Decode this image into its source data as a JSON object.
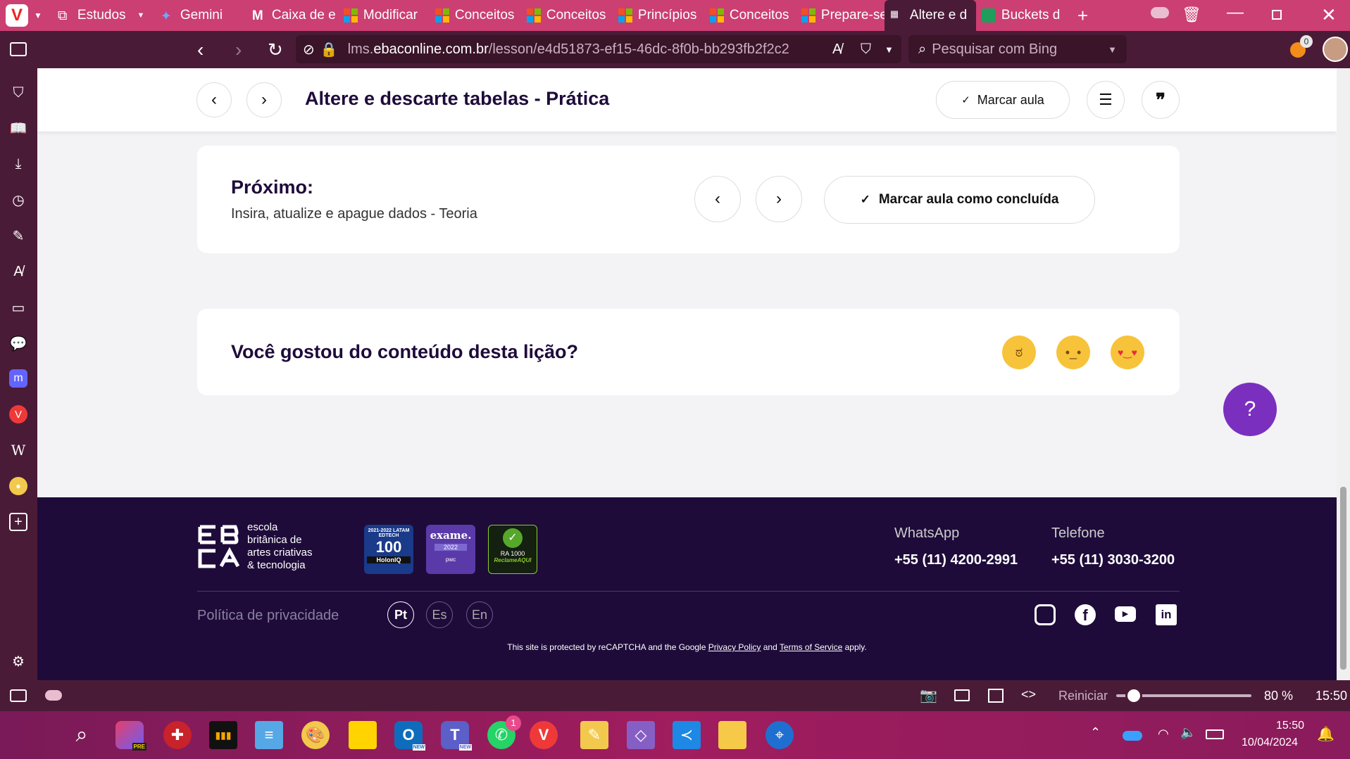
{
  "browser": {
    "tabs": [
      {
        "label": "Estudos",
        "icon": "stack-icon"
      },
      {
        "label": "Gemini",
        "icon": "gemini-icon"
      },
      {
        "label": "Caixa de e",
        "icon": "gmail-icon"
      },
      {
        "label": "Modificar",
        "icon": "microsoft-icon"
      },
      {
        "label": "Conceitos",
        "icon": "microsoft-icon"
      },
      {
        "label": "Conceitos",
        "icon": "microsoft-icon"
      },
      {
        "label": "Princípios",
        "icon": "microsoft-icon"
      },
      {
        "label": "Conceitos",
        "icon": "microsoft-icon"
      },
      {
        "label": "Prepare-se",
        "icon": "microsoft-icon"
      },
      {
        "label": "Altere e d",
        "icon": "ebac-icon",
        "active": true
      },
      {
        "label": "Buckets d",
        "icon": "sheet-icon"
      }
    ],
    "url_prefix": "lms.",
    "url_host": "ebaconline.com.br",
    "url_path": "/lesson/e4d51873-ef15-46dc-8f0b-bb293fb2f2c2",
    "search_placeholder": "Pesquisar com Bing",
    "notification_count": "0"
  },
  "lesson": {
    "title": "Altere e descarte tabelas - Prática",
    "mark_label": "Marcar aula",
    "next_heading": "Próximo:",
    "next_lesson": "Insira, atualize e apague dados - Teoria",
    "complete_label": "Marcar aula como concluída",
    "feedback_question": "Você gostou do conteúdo desta lição?",
    "help_label": "?"
  },
  "footer": {
    "brand_lines": [
      "escola",
      "britânica de",
      "artes criativas",
      "& tecnologia"
    ],
    "badge1_top": "2021-2022 LATAM EDTECH",
    "badge1_num": "100",
    "badge1_bottom": "HolonIQ",
    "badge2_title": "exame.",
    "badge2_year": "2022",
    "badge2_bottom": "pwc",
    "badge3_text": "RA 1000",
    "badge3_bottom": "ReclameAQUI",
    "whatsapp_label": "WhatsApp",
    "whatsapp_number": "+55 (11) 4200-2991",
    "phone_label": "Telefone",
    "phone_number": "+55 (11) 3030-3200",
    "privacy": "Política de privacidade",
    "languages": [
      "Pt",
      "Es",
      "En"
    ],
    "recaptcha_prefix": "This site is protected by reCAPTCHA and the Google ",
    "privacy_policy": "Privacy Policy",
    "recaptcha_and": " and ",
    "terms": "Terms of Service",
    "recaptcha_suffix": " apply."
  },
  "statusbar": {
    "reset": "Reiniciar",
    "zoom": "80 %",
    "zoom_level": 0.13,
    "clock": "15:50"
  },
  "taskbar": {
    "time": "15:50",
    "date": "10/04/2024",
    "whatsapp_badge": "1",
    "new_label": "NEW",
    "pre_label": "PRE"
  },
  "colors": {
    "tabbar": "#cb3f72",
    "chrome": "#4a1b37",
    "footer": "#1e0b3a",
    "help": "#7b2fbf"
  }
}
